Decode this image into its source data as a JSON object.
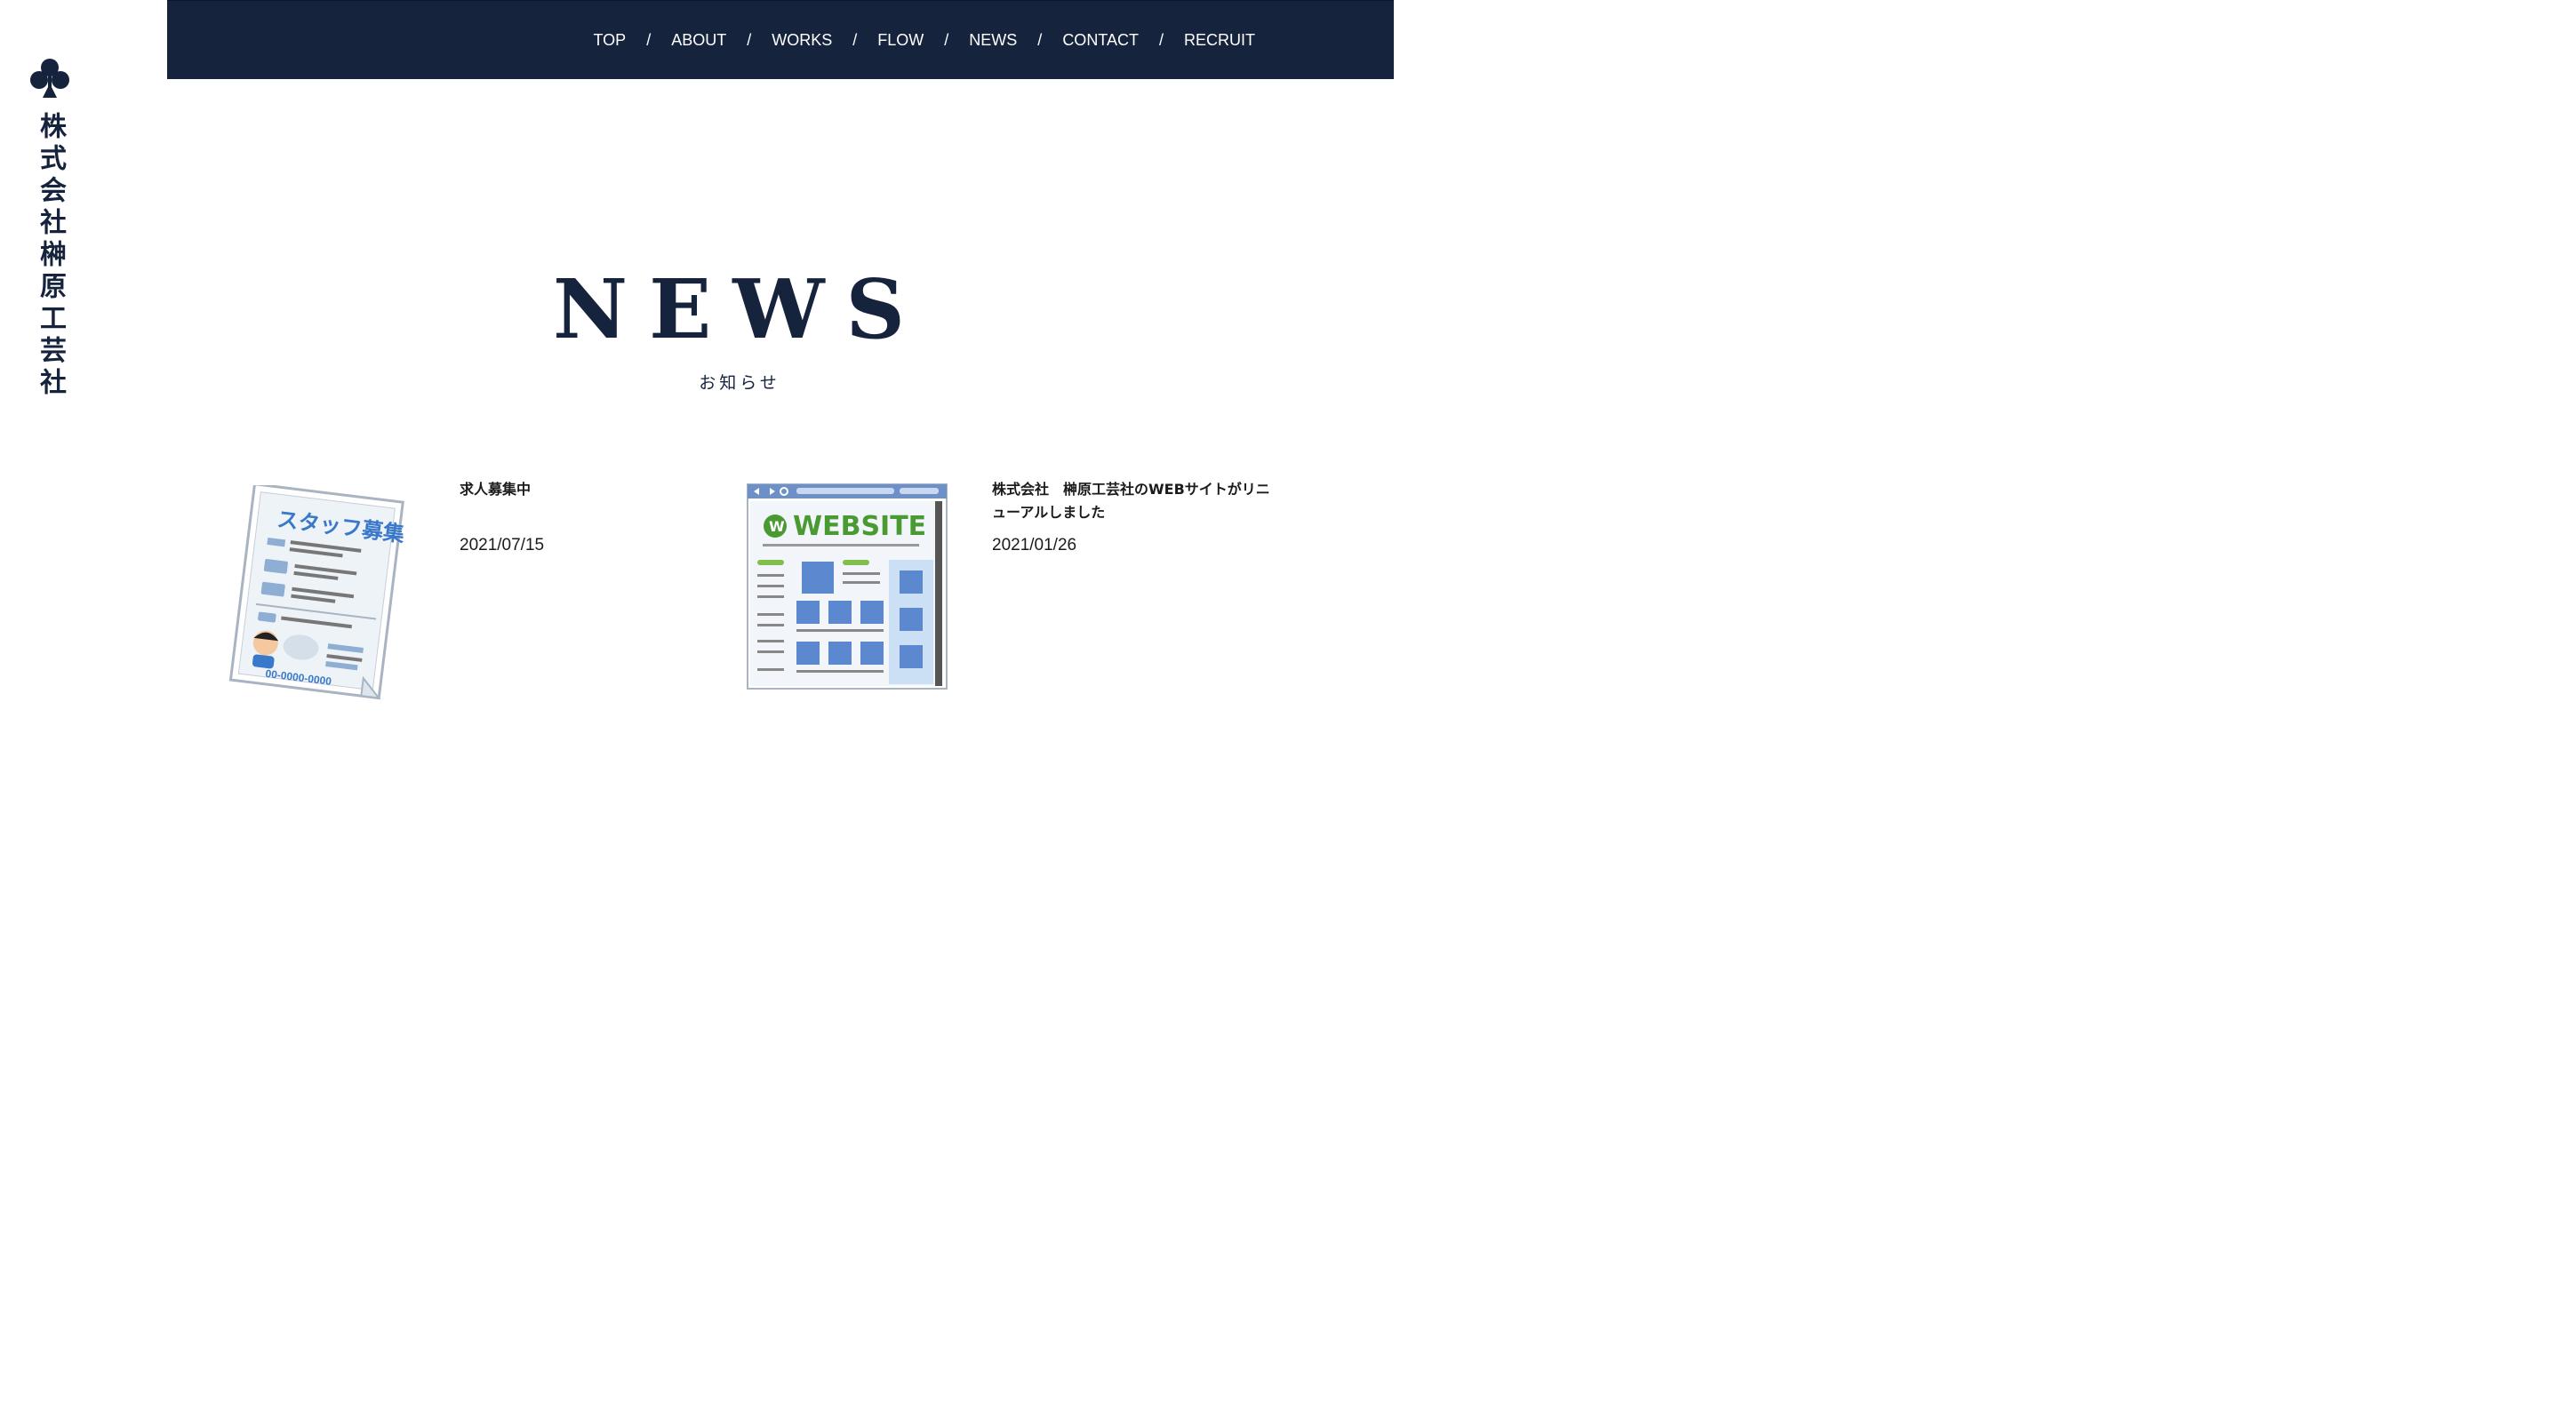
{
  "site": {
    "company_name": "株式会社榊原工芸社"
  },
  "nav": {
    "items": [
      {
        "label": "TOP"
      },
      {
        "label": "ABOUT"
      },
      {
        "label": "WORKS"
      },
      {
        "label": "FLOW"
      },
      {
        "label": "NEWS"
      },
      {
        "label": "CONTACT"
      },
      {
        "label": "RECRUIT"
      }
    ],
    "separator": "/"
  },
  "section": {
    "title": "NEWS",
    "subtitle": "お知らせ"
  },
  "news": [
    {
      "title": "求人募集中",
      "date": "2021/07/15",
      "thumb": {
        "icon": "staff-recruitment-flyer",
        "heading": "スタッフ募集",
        "phone": "00-0000-0000"
      }
    },
    {
      "title": "株式会社　榊原工芸社のWEBサイトがリニューアルしました",
      "date": "2021/01/26",
      "thumb": {
        "icon": "website-browser-window",
        "badge": "W",
        "heading": "WEBSITE"
      }
    }
  ],
  "colors": {
    "navy": "#16233d",
    "accent_blue": "#3a78c9",
    "accent_green": "#4a9a32"
  }
}
